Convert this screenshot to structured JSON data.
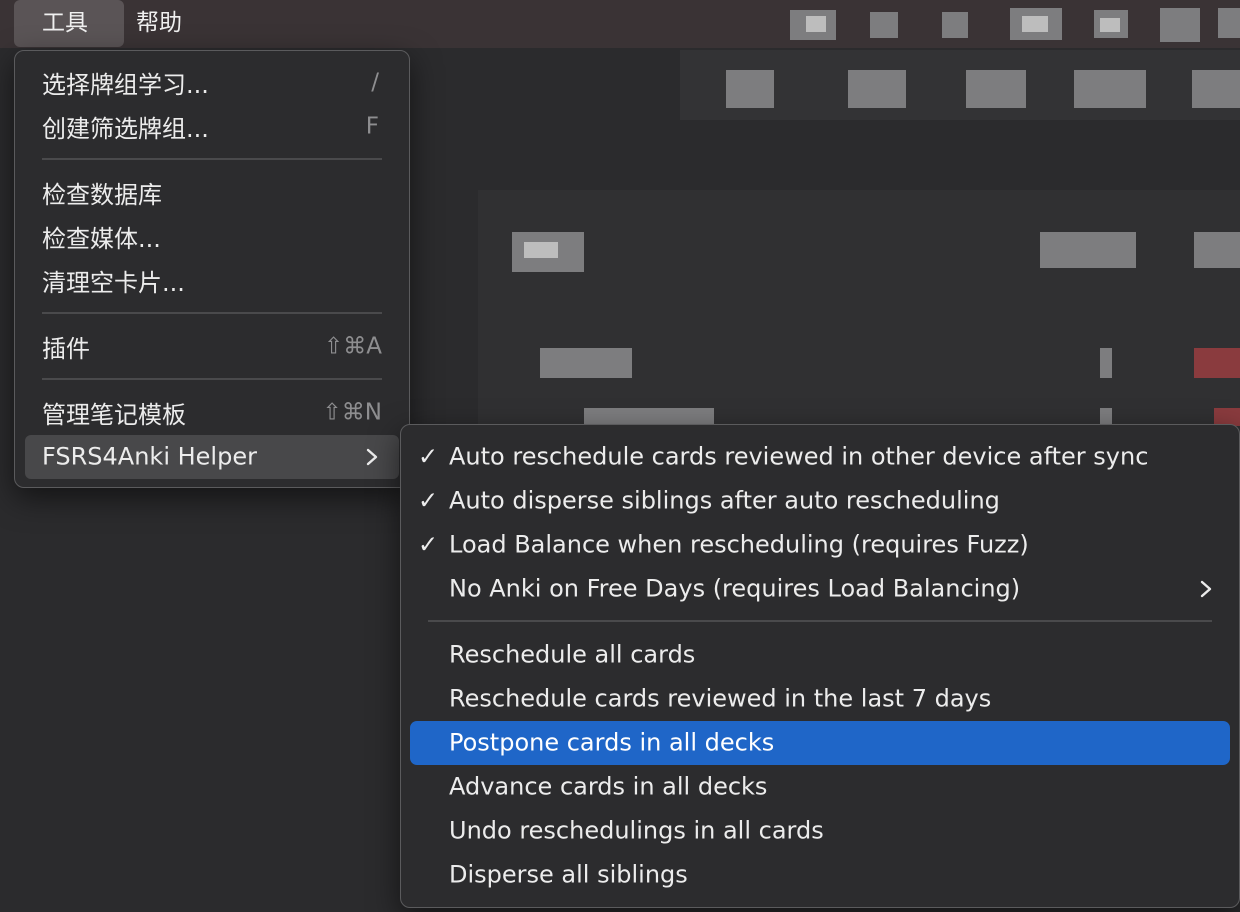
{
  "menubar": {
    "items": [
      {
        "label": "工具",
        "active": true
      },
      {
        "label": "帮助",
        "active": false
      }
    ]
  },
  "tools_menu": {
    "groups": [
      [
        {
          "label": "选择牌组学习...",
          "shortcut": "/"
        },
        {
          "label": "创建筛选牌组...",
          "shortcut": "F"
        }
      ],
      [
        {
          "label": "检查数据库",
          "shortcut": ""
        },
        {
          "label": "检查媒体...",
          "shortcut": ""
        },
        {
          "label": "清理空卡片...",
          "shortcut": ""
        }
      ],
      [
        {
          "label": "插件",
          "shortcut": "⇧⌘A"
        }
      ],
      [
        {
          "label": "管理笔记模板",
          "shortcut": "⇧⌘N"
        },
        {
          "label": "FSRS4Anki Helper",
          "shortcut": "",
          "submenu": true,
          "hovered": true
        }
      ]
    ]
  },
  "helper_submenu": {
    "options": [
      {
        "label": "Auto reschedule cards reviewed in other device after sync",
        "checked": true
      },
      {
        "label": "Auto disperse siblings after auto rescheduling",
        "checked": true
      },
      {
        "label": "Load Balance when rescheduling (requires Fuzz)",
        "checked": true
      },
      {
        "label": "No Anki on Free Days (requires Load Balancing)",
        "checked": false,
        "submenu": true
      }
    ],
    "actions": [
      {
        "label": "Reschedule all cards",
        "highlighted": false
      },
      {
        "label": "Reschedule cards reviewed in the last 7 days",
        "highlighted": false
      },
      {
        "label": "Postpone cards in all decks",
        "highlighted": true
      },
      {
        "label": "Advance cards in all decks",
        "highlighted": false
      },
      {
        "label": "Undo reschedulings in all cards",
        "highlighted": false
      },
      {
        "label": "Disperse all siblings",
        "highlighted": false
      }
    ],
    "check_glyph": "✓"
  },
  "colors": {
    "highlight": "#1f66c8",
    "menu_bg": "#2c2c2e",
    "menubar_bg": "#3a3335"
  }
}
